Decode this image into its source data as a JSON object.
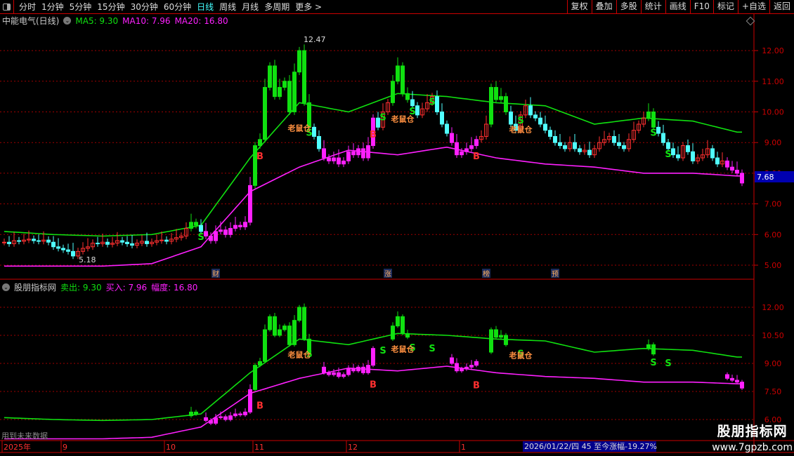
{
  "toolbar": {
    "periods": [
      "分时",
      "1分钟",
      "5分钟",
      "15分钟",
      "30分钟",
      "60分钟",
      "日线",
      "周线",
      "月线",
      "多周期",
      "更多 >"
    ],
    "active": "日线",
    "right_buttons": [
      "复权",
      "叠加",
      "多股",
      "统计",
      "画线",
      "F10",
      "标记",
      "+自选",
      "返回"
    ]
  },
  "main_panel": {
    "title": "中能电气(日线)",
    "ma5": "MA5: 9.30",
    "ma10": "MA10: 7.96",
    "ma20": "MA20: 16.80",
    "axis": [
      "12.00",
      "11.00",
      "10.00",
      "9.00",
      "8.00",
      "7.00",
      "6.00",
      "5.00"
    ],
    "axis_values": [
      12,
      11,
      10,
      9,
      8,
      7,
      6,
      5
    ],
    "current_price": "7.68",
    "high_label": "12.47",
    "low_label": "5.18",
    "events": [
      {
        "text": "财",
        "idx": 43
      },
      {
        "text": "涨",
        "idx": 78
      },
      {
        "text": "榜",
        "idx": 98
      },
      {
        "text": "预",
        "idx": 112
      }
    ]
  },
  "sub_panel": {
    "title": "股朋指标网",
    "sell": "卖出: 9.30",
    "buy": "买入: 7.96",
    "range": "幅度: 16.80",
    "axis": [
      "12.00",
      "10.50",
      "9.00",
      "7.50",
      "6.00"
    ],
    "axis_values": [
      12,
      10.5,
      9,
      7.5,
      6
    ],
    "note": "用到未来数据"
  },
  "date_axis": {
    "labels": [
      {
        "text": "2025年",
        "idx": 0
      },
      {
        "text": "9",
        "idx": 12
      },
      {
        "text": "10",
        "idx": 33
      },
      {
        "text": "11",
        "idx": 51
      },
      {
        "text": "12",
        "idx": 70
      },
      {
        "text": "1",
        "idx": 93
      }
    ]
  },
  "status": "2026/01/22/四 45 至今涨幅-19.27%",
  "watermark": {
    "name": "股朋指标网",
    "url": "www.7gpzb.com"
  },
  "colors": {
    "up": "#ff3030",
    "down": "#50ffff",
    "green": "#10e010",
    "magenta": "#ff20ff",
    "grid": "#a00000"
  },
  "chart_data": {
    "type": "candlestick",
    "closes": [
      5.75,
      5.7,
      5.8,
      5.78,
      5.82,
      5.85,
      5.8,
      5.78,
      5.82,
      5.75,
      5.6,
      5.55,
      5.5,
      5.45,
      5.3,
      5.45,
      5.55,
      5.6,
      5.72,
      5.7,
      5.75,
      5.68,
      5.72,
      5.8,
      5.75,
      5.7,
      5.65,
      5.72,
      5.78,
      5.7,
      5.75,
      5.8,
      5.82,
      5.78,
      5.85,
      5.9,
      5.95,
      6.2,
      6.4,
      6.3,
      6.1,
      5.95,
      5.8,
      6.1,
      6.15,
      6.0,
      6.2,
      6.3,
      6.25,
      6.4,
      7.6,
      8.9,
      9.1,
      10.8,
      11.5,
      10.5,
      10.8,
      11.0,
      10.0,
      11.3,
      12.0,
      10.3,
      9.5,
      9.2,
      8.8,
      8.5,
      8.4,
      8.5,
      8.3,
      8.4,
      8.7,
      8.6,
      8.8,
      8.5,
      8.9,
      9.8,
      9.5,
      10.0,
      10.3,
      11.0,
      11.5,
      10.6,
      10.4,
      10.2,
      9.9,
      10.1,
      10.3,
      10.5,
      10.0,
      9.6,
      9.3,
      9.0,
      8.6,
      8.7,
      8.8,
      8.9,
      9.1,
      9.2,
      9.6,
      10.8,
      10.4,
      10.5,
      10.0,
      9.6,
      9.4,
      9.9,
      10.2,
      9.9,
      9.8,
      9.6,
      9.4,
      9.2,
      9.0,
      8.9,
      8.8,
      9.0,
      8.8,
      8.7,
      8.75,
      8.6,
      8.8,
      9.0,
      9.1,
      9.2,
      9.0,
      8.9,
      8.8,
      9.1,
      9.4,
      9.6,
      9.8,
      10.0,
      9.5,
      9.3,
      9.0,
      8.8,
      8.6,
      8.5,
      8.9,
      8.7,
      8.4,
      8.5,
      8.6,
      8.8,
      8.5,
      8.3,
      8.4,
      8.2,
      8.1,
      8.0,
      7.68
    ],
    "upper_line": [
      6.1,
      6.0,
      5.95,
      6.0,
      6.3,
      8.5,
      10.3,
      10.0,
      10.6,
      10.5,
      10.3,
      10.2,
      9.6,
      9.8,
      9.7,
      9.3
    ],
    "lower_line": [
      4.97,
      4.97,
      4.97,
      5.05,
      5.6,
      7.4,
      8.2,
      8.75,
      8.6,
      8.85,
      8.5,
      8.3,
      8.2,
      8.0,
      8.0,
      7.9
    ],
    "signals": [
      {
        "t": "S",
        "idx": 40
      },
      {
        "t": "B",
        "idx": 52
      },
      {
        "t": "S",
        "idx": 62
      },
      {
        "t": "B",
        "idx": 75
      },
      {
        "t": "S",
        "idx": 77
      },
      {
        "t": "S",
        "idx": 83
      },
      {
        "t": "S",
        "idx": 87
      },
      {
        "t": "B",
        "idx": 96
      },
      {
        "t": "S",
        "idx": 105
      },
      {
        "t": "S",
        "idx": 132
      },
      {
        "t": "S",
        "idx": 135
      },
      {
        "t": "老鼠仓",
        "idx": 60
      },
      {
        "t": "老鼠仓",
        "idx": 81
      },
      {
        "t": "老鼠仓",
        "idx": 105
      }
    ]
  }
}
